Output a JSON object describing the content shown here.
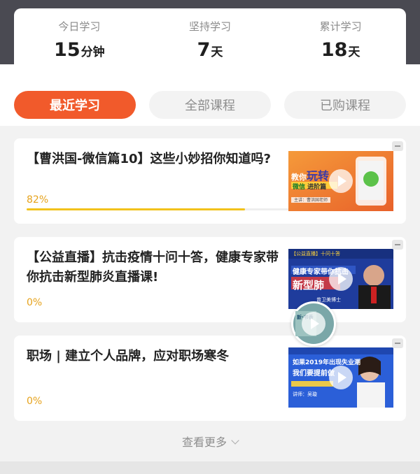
{
  "stats": [
    {
      "label": "今日学习",
      "value": "15",
      "unit": "分钟"
    },
    {
      "label": "坚持学习",
      "value": "7",
      "unit": "天"
    },
    {
      "label": "累计学习",
      "value": "18",
      "unit": "天"
    }
  ],
  "tabs": [
    {
      "label": "最近学习",
      "active": true
    },
    {
      "label": "全部课程",
      "active": false
    },
    {
      "label": "已购课程",
      "active": false
    }
  ],
  "courses": [
    {
      "title": "【曹洪国-微信篇10】这些小妙招你知道吗?",
      "progress_text": "82%",
      "progress": 0.82,
      "thumb": {
        "line1": "教你",
        "line2": "玩转",
        "line3": "微信",
        "line4": "进阶篇",
        "line5": "主讲：曹洪国老师"
      }
    },
    {
      "title": "【公益直播】抗击疫情十问十答，健康专家带你抗击新型肺炎直播课!",
      "progress_text": "0%",
      "progress": 0,
      "thumb": {
        "line1": "【公益直播】十问十答",
        "line2": "健康专家带你抗击",
        "line3": "新型肺",
        "line4": "曾卫美博士"
      }
    },
    {
      "title": "职场 | 建立个人品牌，应对职场寒冬",
      "progress_text": "0%",
      "progress": 0,
      "thumb": {
        "line1": "如果2019年出现失业潮",
        "line2": "我们要提前做",
        "line3": "讲师：吴璇"
      }
    }
  ],
  "float_thumb": {
    "line1": "新·书香"
  },
  "more_label": "查看更多",
  "colors": {
    "accent": "#f15a2b",
    "progress": "#f2c21b",
    "progress_text": "#e6a21b"
  }
}
